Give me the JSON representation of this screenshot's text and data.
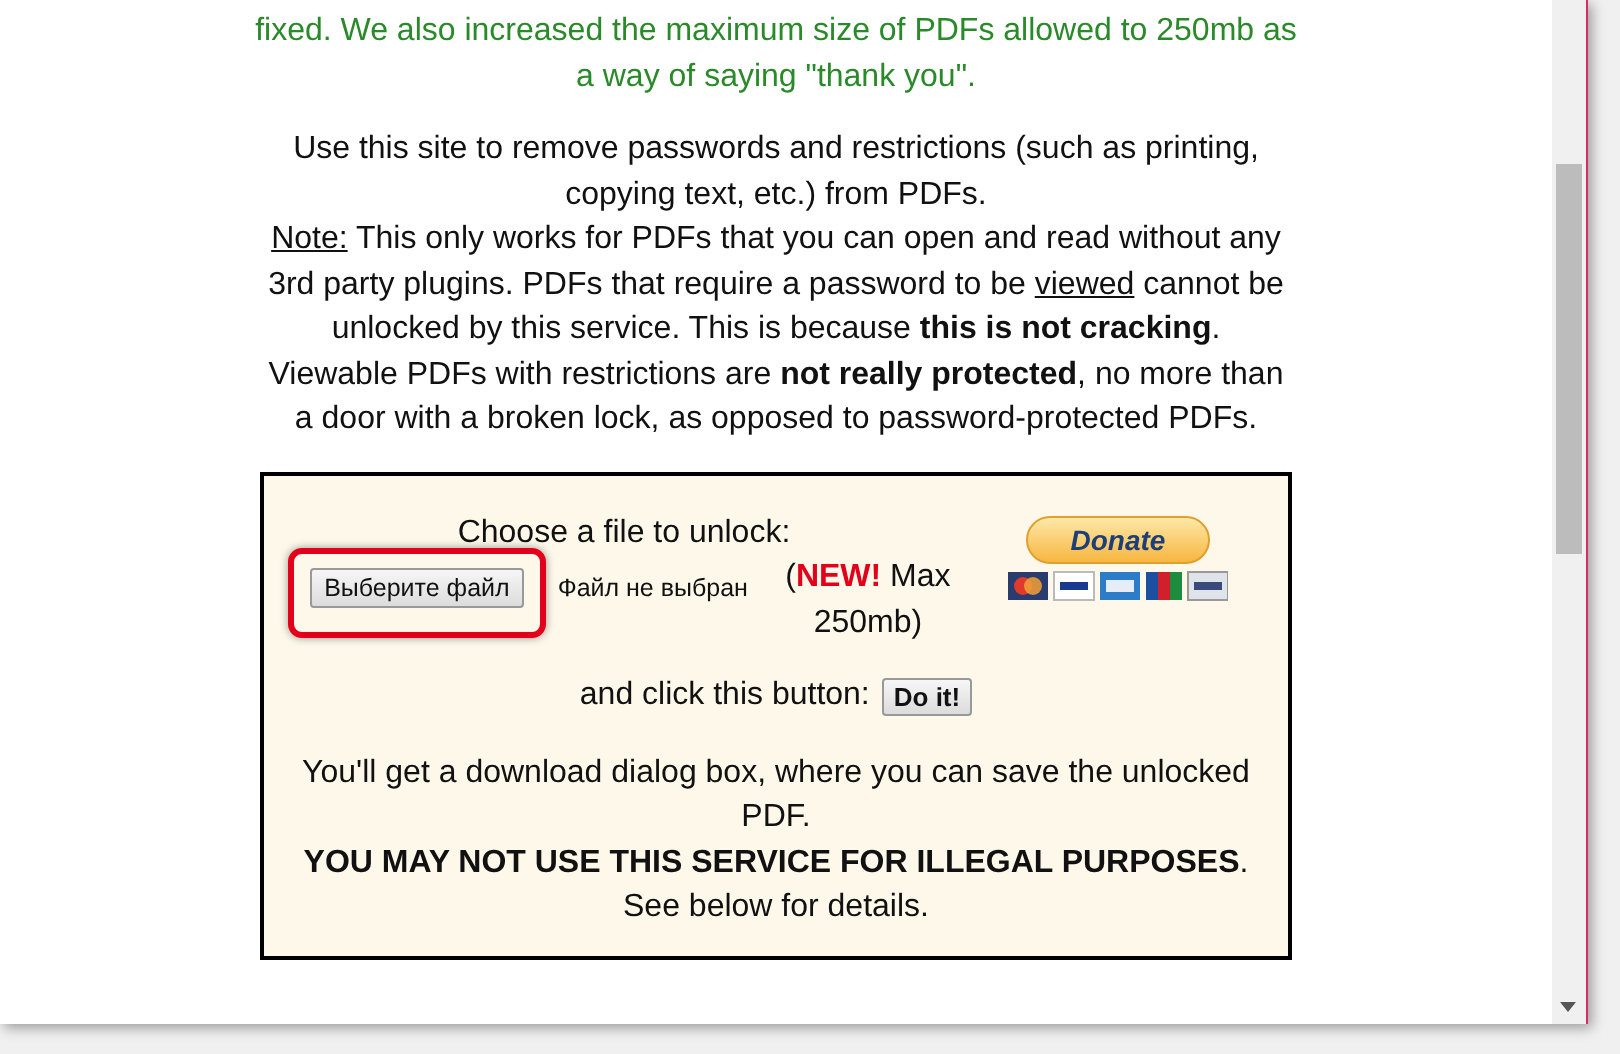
{
  "notice": {
    "text": "fixed. We also increased the maximum size of PDFs allowed to 250mb as a way of saying \"thank you\"."
  },
  "intro": {
    "text": "Use this site to remove passwords and restrictions (such as printing, copying text, etc.) from PDFs."
  },
  "note": {
    "parts": [
      {
        "kind": "underlined",
        "text": "Note:"
      },
      {
        "kind": "plain",
        "text": " This only works for PDFs that you can open and read without any 3rd party plugins. PDFs that require a password to be "
      },
      {
        "kind": "underlined",
        "text": "viewed"
      },
      {
        "kind": "plain",
        "text": " cannot be unlocked by this service. This is because **this is not cracking**. Viewable PDFs with restrictions are **not really protected**, no more than a door with a broken lock, as opposed to password-protected PDFs."
      }
    ]
  },
  "upload": {
    "prompt": "Choose a file to unlock:",
    "file_button": "Выберите файл",
    "file_status": "Файл не выбран",
    "max_note": "(**NEW!** Max 250mb)",
    "submit_label": "and click this button:",
    "submit_button": "Do it!",
    "donate_button": "Donate",
    "info": "You'll get a download dialog box, where you can save the unlocked PDF.",
    "warning": "**YOU MAY NOT USE THIS SERVICE FOR ILLEGAL PURPOSES**. See below for details."
  }
}
